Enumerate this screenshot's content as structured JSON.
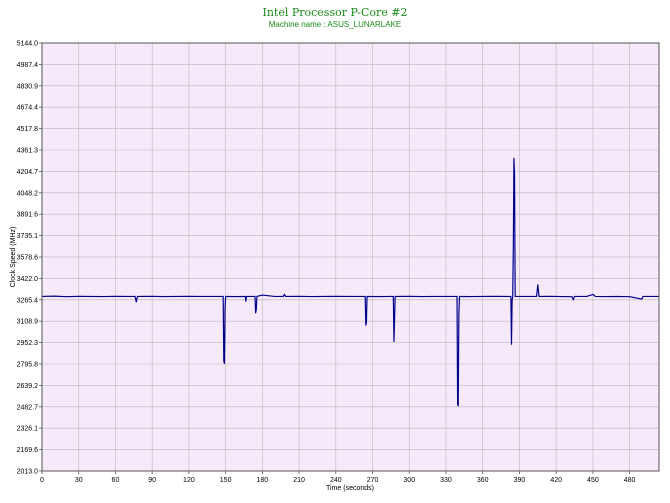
{
  "colors": {
    "title": "#1a8a1a",
    "plot_bg": "#f6e9fa",
    "grid": "#b9b9b9",
    "line": "#00008b"
  },
  "chart_data": {
    "type": "line",
    "title": "Intel Processor P-Core #2",
    "subtitle": "Machine name : ASUS_LUNARLAKE",
    "xlabel": "Time (seconds)",
    "ylabel": "Clock Speed (MHz)",
    "xlim": [
      0,
      504
    ],
    "ylim": [
      2013.0,
      5144.0
    ],
    "xticks": [
      0,
      30,
      60,
      90,
      120,
      150,
      180,
      210,
      240,
      270,
      300,
      330,
      360,
      390,
      420,
      450,
      480
    ],
    "yticks": [
      2013.0,
      2169.6,
      2326.1,
      2482.7,
      2639.2,
      2795.8,
      2952.3,
      3108.9,
      3265.4,
      3422.0,
      3578.6,
      3735.1,
      3891.6,
      4048.2,
      4204.7,
      4361.3,
      4517.8,
      4674.4,
      4830.9,
      4987.4,
      5144.0
    ],
    "grid": true,
    "series": [
      {
        "baseline": 3290,
        "points": [
          [
            0,
            3290
          ],
          [
            10,
            3292
          ],
          [
            20,
            3288
          ],
          [
            30,
            3291
          ],
          [
            40,
            3290
          ],
          [
            50,
            3289
          ],
          [
            60,
            3291
          ],
          [
            70,
            3290
          ],
          [
            76,
            3290
          ],
          [
            77,
            3250
          ],
          [
            78,
            3290
          ],
          [
            90,
            3291
          ],
          [
            100,
            3289
          ],
          [
            110,
            3290
          ],
          [
            120,
            3291
          ],
          [
            130,
            3290
          ],
          [
            140,
            3290
          ],
          [
            148,
            3290
          ],
          [
            148.5,
            2820
          ],
          [
            149,
            2800
          ],
          [
            149.5,
            3200
          ],
          [
            150,
            3290
          ],
          [
            160,
            3289
          ],
          [
            166,
            3290
          ],
          [
            166.5,
            3255
          ],
          [
            167,
            3290
          ],
          [
            174,
            3290
          ],
          [
            174.5,
            3170
          ],
          [
            175,
            3190
          ],
          [
            175.5,
            3290
          ],
          [
            180,
            3300
          ],
          [
            190,
            3290
          ],
          [
            197,
            3290
          ],
          [
            198,
            3305
          ],
          [
            199,
            3290
          ],
          [
            210,
            3291
          ],
          [
            220,
            3289
          ],
          [
            230,
            3290
          ],
          [
            240,
            3291
          ],
          [
            250,
            3290
          ],
          [
            260,
            3290
          ],
          [
            264,
            3290
          ],
          [
            264.5,
            3080
          ],
          [
            265,
            3100
          ],
          [
            265.5,
            3290
          ],
          [
            275,
            3289
          ],
          [
            285,
            3290
          ],
          [
            287,
            3290
          ],
          [
            287.5,
            2960
          ],
          [
            288,
            3120
          ],
          [
            288.5,
            3290
          ],
          [
            300,
            3291
          ],
          [
            310,
            3289
          ],
          [
            320,
            3290
          ],
          [
            330,
            3290
          ],
          [
            339,
            3290
          ],
          [
            339.5,
            2500
          ],
          [
            340,
            2490
          ],
          [
            340.5,
            3150
          ],
          [
            341,
            3290
          ],
          [
            350,
            3289
          ],
          [
            360,
            3290
          ],
          [
            370,
            3291
          ],
          [
            380,
            3290
          ],
          [
            383,
            3290
          ],
          [
            383.5,
            2940
          ],
          [
            384,
            3260
          ],
          [
            384.5,
            3290
          ],
          [
            385,
            3650
          ],
          [
            385.5,
            4300
          ],
          [
            386,
            4180
          ],
          [
            386.5,
            3290
          ],
          [
            395,
            3290
          ],
          [
            404,
            3290
          ],
          [
            405,
            3375
          ],
          [
            406,
            3290
          ],
          [
            415,
            3291
          ],
          [
            425,
            3289
          ],
          [
            433,
            3288
          ],
          [
            434,
            3265
          ],
          [
            435,
            3290
          ],
          [
            445,
            3290
          ],
          [
            450,
            3305
          ],
          [
            452,
            3290
          ],
          [
            460,
            3289
          ],
          [
            470,
            3290
          ],
          [
            480,
            3288
          ],
          [
            490,
            3271
          ],
          [
            491,
            3290
          ],
          [
            504,
            3290
          ]
        ]
      }
    ]
  }
}
